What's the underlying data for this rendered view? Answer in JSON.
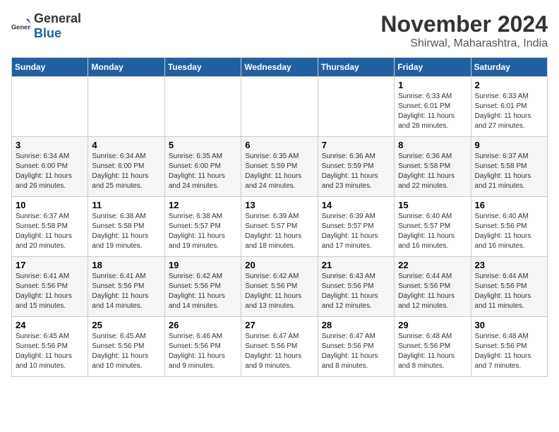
{
  "logo": {
    "general": "General",
    "blue": "Blue"
  },
  "title": "November 2024",
  "subtitle": "Shirwal, Maharashtra, India",
  "weekdays": [
    "Sunday",
    "Monday",
    "Tuesday",
    "Wednesday",
    "Thursday",
    "Friday",
    "Saturday"
  ],
  "weeks": [
    [
      {
        "day": "",
        "info": ""
      },
      {
        "day": "",
        "info": ""
      },
      {
        "day": "",
        "info": ""
      },
      {
        "day": "",
        "info": ""
      },
      {
        "day": "",
        "info": ""
      },
      {
        "day": "1",
        "info": "Sunrise: 6:33 AM\nSunset: 6:01 PM\nDaylight: 11 hours and 28 minutes."
      },
      {
        "day": "2",
        "info": "Sunrise: 6:33 AM\nSunset: 6:01 PM\nDaylight: 11 hours and 27 minutes."
      }
    ],
    [
      {
        "day": "3",
        "info": "Sunrise: 6:34 AM\nSunset: 6:00 PM\nDaylight: 11 hours and 26 minutes."
      },
      {
        "day": "4",
        "info": "Sunrise: 6:34 AM\nSunset: 6:00 PM\nDaylight: 11 hours and 25 minutes."
      },
      {
        "day": "5",
        "info": "Sunrise: 6:35 AM\nSunset: 6:00 PM\nDaylight: 11 hours and 24 minutes."
      },
      {
        "day": "6",
        "info": "Sunrise: 6:35 AM\nSunset: 5:59 PM\nDaylight: 11 hours and 24 minutes."
      },
      {
        "day": "7",
        "info": "Sunrise: 6:36 AM\nSunset: 5:59 PM\nDaylight: 11 hours and 23 minutes."
      },
      {
        "day": "8",
        "info": "Sunrise: 6:36 AM\nSunset: 5:58 PM\nDaylight: 11 hours and 22 minutes."
      },
      {
        "day": "9",
        "info": "Sunrise: 6:37 AM\nSunset: 5:58 PM\nDaylight: 11 hours and 21 minutes."
      }
    ],
    [
      {
        "day": "10",
        "info": "Sunrise: 6:37 AM\nSunset: 5:58 PM\nDaylight: 11 hours and 20 minutes."
      },
      {
        "day": "11",
        "info": "Sunrise: 6:38 AM\nSunset: 5:58 PM\nDaylight: 11 hours and 19 minutes."
      },
      {
        "day": "12",
        "info": "Sunrise: 6:38 AM\nSunset: 5:57 PM\nDaylight: 11 hours and 19 minutes."
      },
      {
        "day": "13",
        "info": "Sunrise: 6:39 AM\nSunset: 5:57 PM\nDaylight: 11 hours and 18 minutes."
      },
      {
        "day": "14",
        "info": "Sunrise: 6:39 AM\nSunset: 5:57 PM\nDaylight: 11 hours and 17 minutes."
      },
      {
        "day": "15",
        "info": "Sunrise: 6:40 AM\nSunset: 5:57 PM\nDaylight: 11 hours and 16 minutes."
      },
      {
        "day": "16",
        "info": "Sunrise: 6:40 AM\nSunset: 5:56 PM\nDaylight: 11 hours and 16 minutes."
      }
    ],
    [
      {
        "day": "17",
        "info": "Sunrise: 6:41 AM\nSunset: 5:56 PM\nDaylight: 11 hours and 15 minutes."
      },
      {
        "day": "18",
        "info": "Sunrise: 6:41 AM\nSunset: 5:56 PM\nDaylight: 11 hours and 14 minutes."
      },
      {
        "day": "19",
        "info": "Sunrise: 6:42 AM\nSunset: 5:56 PM\nDaylight: 11 hours and 14 minutes."
      },
      {
        "day": "20",
        "info": "Sunrise: 6:42 AM\nSunset: 5:56 PM\nDaylight: 11 hours and 13 minutes."
      },
      {
        "day": "21",
        "info": "Sunrise: 6:43 AM\nSunset: 5:56 PM\nDaylight: 11 hours and 12 minutes."
      },
      {
        "day": "22",
        "info": "Sunrise: 6:44 AM\nSunset: 5:56 PM\nDaylight: 11 hours and 12 minutes."
      },
      {
        "day": "23",
        "info": "Sunrise: 6:44 AM\nSunset: 5:56 PM\nDaylight: 11 hours and 11 minutes."
      }
    ],
    [
      {
        "day": "24",
        "info": "Sunrise: 6:45 AM\nSunset: 5:56 PM\nDaylight: 11 hours and 10 minutes."
      },
      {
        "day": "25",
        "info": "Sunrise: 6:45 AM\nSunset: 5:56 PM\nDaylight: 11 hours and 10 minutes."
      },
      {
        "day": "26",
        "info": "Sunrise: 6:46 AM\nSunset: 5:56 PM\nDaylight: 11 hours and 9 minutes."
      },
      {
        "day": "27",
        "info": "Sunrise: 6:47 AM\nSunset: 5:56 PM\nDaylight: 11 hours and 9 minutes."
      },
      {
        "day": "28",
        "info": "Sunrise: 6:47 AM\nSunset: 5:56 PM\nDaylight: 11 hours and 8 minutes."
      },
      {
        "day": "29",
        "info": "Sunrise: 6:48 AM\nSunset: 5:56 PM\nDaylight: 11 hours and 8 minutes."
      },
      {
        "day": "30",
        "info": "Sunrise: 6:48 AM\nSunset: 5:56 PM\nDaylight: 11 hours and 7 minutes."
      }
    ]
  ]
}
